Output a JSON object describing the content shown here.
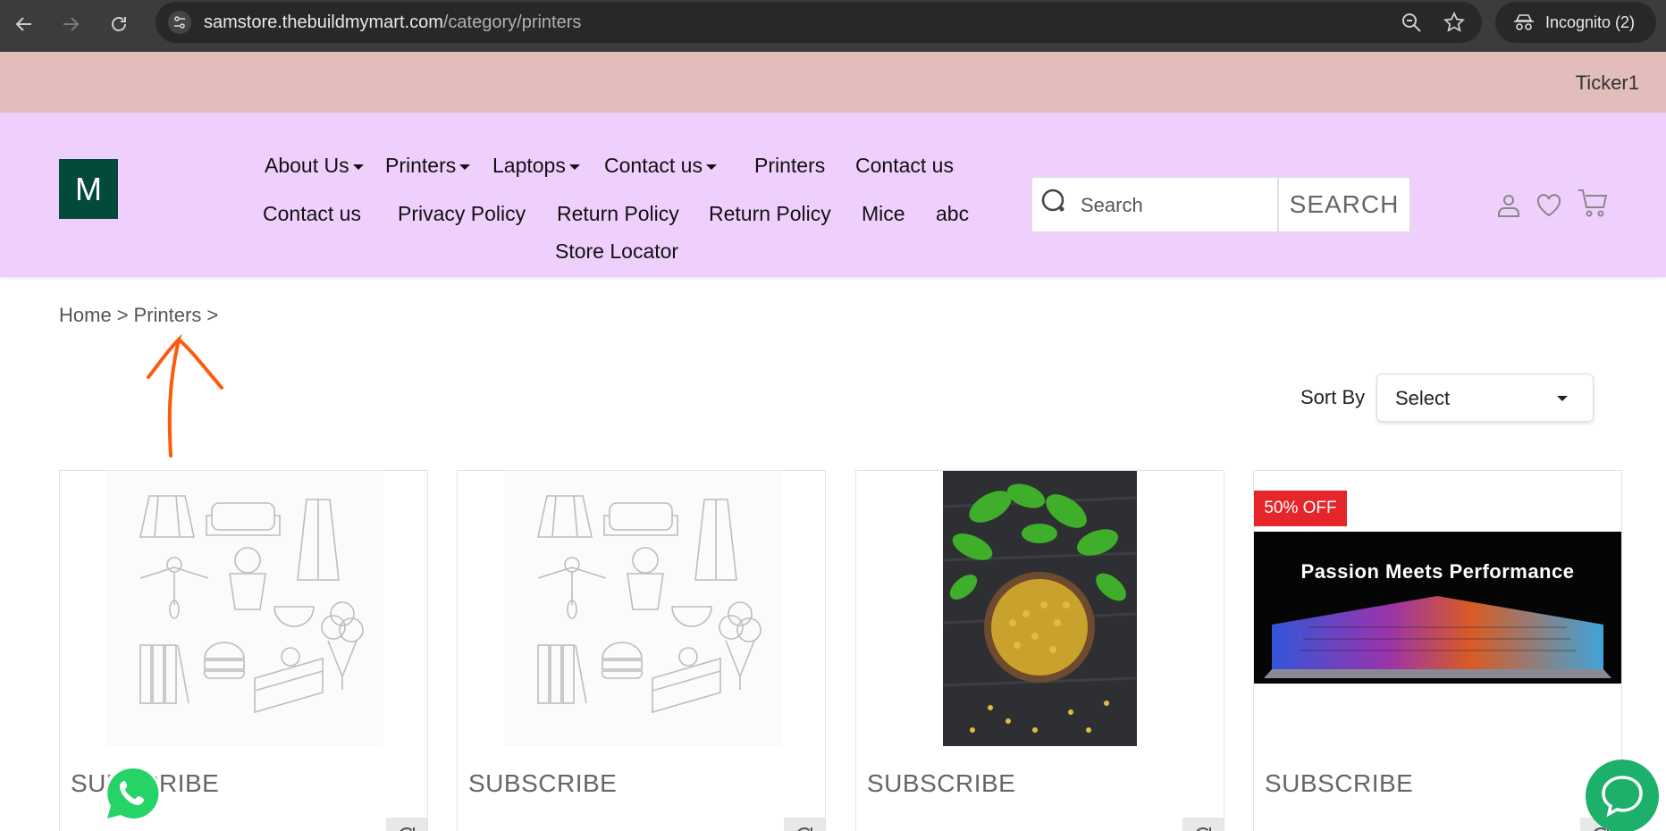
{
  "browser": {
    "url_host": "samstore.thebuildmymart.com",
    "url_path": "/category/printers",
    "profile_label": "Incognito (2)"
  },
  "ticker": {
    "text": "Ticker1"
  },
  "header": {
    "logo_letter": "M",
    "nav": [
      {
        "label": "About Us",
        "dropdown": true
      },
      {
        "label": "Printers",
        "dropdown": true
      },
      {
        "label": "Laptops",
        "dropdown": true
      },
      {
        "label": "Contact us",
        "dropdown": true
      },
      {
        "label": "Printers",
        "dropdown": false
      },
      {
        "label": "Contact us",
        "dropdown": false
      },
      {
        "label": "Contact us",
        "dropdown": false
      },
      {
        "label": "Privacy Policy",
        "dropdown": false
      },
      {
        "label": "Return Policy",
        "dropdown": false
      },
      {
        "label": "Return Policy",
        "dropdown": false
      },
      {
        "label": "Mice",
        "dropdown": false
      },
      {
        "label": "abc",
        "dropdown": false
      },
      {
        "label": "Store Locator",
        "dropdown": false
      }
    ],
    "search": {
      "placeholder": "Search",
      "button_label": "SEARCH"
    }
  },
  "breadcrumb": {
    "home": "Home",
    "sep": ">",
    "current": "Printers"
  },
  "sort": {
    "label": "Sort By",
    "selected": "Select"
  },
  "products": [
    {
      "title": "SUBSCRIBE",
      "image": "placeholder-illustration",
      "badge": ""
    },
    {
      "title": "SUBSCRIBE",
      "image": "placeholder-illustration",
      "badge": ""
    },
    {
      "title": "SUBSCRIBE",
      "image": "fenugreek-seeds-photo",
      "badge": ""
    },
    {
      "title": "SUBSCRIBE",
      "image": "laptop-banner",
      "badge": "50% OFF",
      "banner_text": "Passion Meets Performance"
    }
  ],
  "colors": {
    "ticker_bg": "#e2bdbb",
    "header_bg": "#efd0fd",
    "logo_bg": "#044a3c",
    "badge_bg": "#e5262a",
    "whatsapp": "#25d366",
    "chat": "#1db06a"
  }
}
